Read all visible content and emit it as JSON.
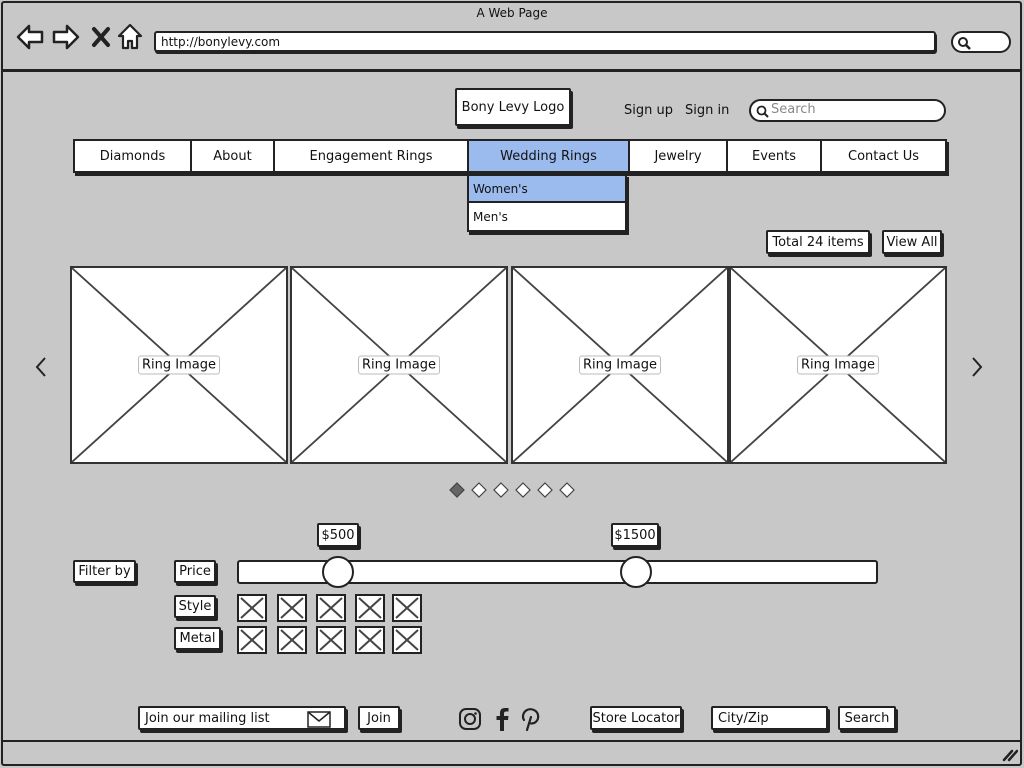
{
  "browser": {
    "title": "A Web Page",
    "url": "http://bonylevy.com",
    "nav_icons": [
      "back-arrow-icon",
      "forward-arrow-icon",
      "close-icon",
      "home-icon"
    ]
  },
  "header": {
    "logo": "Bony Levy Logo",
    "sign_up": "Sign up",
    "sign_in": "Sign in",
    "search_placeholder": "Search"
  },
  "menu": {
    "items": [
      "Diamonds",
      "About",
      "Engagement Rings",
      "Wedding Rings",
      "Jewelry",
      "Events",
      "Contact Us"
    ],
    "active": "Wedding Rings"
  },
  "dropdown": {
    "items": [
      "Women's",
      "Men's"
    ],
    "selected": "Women's"
  },
  "catalog": {
    "total": "Total 24 items",
    "view_all": "View All",
    "tiles": [
      "Ring Image",
      "Ring Image",
      "Ring Image",
      "Ring Image"
    ],
    "carousel": {
      "pages": 6,
      "current": 1
    }
  },
  "filters": {
    "title": "Filter by",
    "price_label": "Price",
    "style_label": "Style",
    "metal_label": "Metal",
    "price_min": "$500",
    "price_max": "$1500",
    "style_options": 5,
    "metal_options": 5
  },
  "footer": {
    "mailing_placeholder": "Join our mailing list",
    "join": "Join",
    "social": [
      "instagram-icon",
      "facebook-icon",
      "pinterest-icon"
    ],
    "store_locator": "Store Locator",
    "city_zip_placeholder": "City/Zip",
    "search": "Search"
  }
}
